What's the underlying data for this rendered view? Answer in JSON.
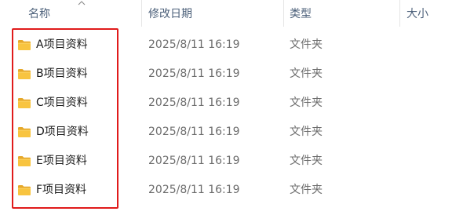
{
  "columns": {
    "name": "名称",
    "date": "修改日期",
    "type": "类型",
    "size": "大小"
  },
  "sort": {
    "column": "name",
    "direction": "ascending",
    "icon": "chevron-up-icon"
  },
  "items": [
    {
      "name": "A项目资料",
      "modified": "2025/8/11 16:19",
      "type": "文件夹",
      "icon": "folder-icon"
    },
    {
      "name": "B项目资料",
      "modified": "2025/8/11 16:19",
      "type": "文件夹",
      "icon": "folder-icon"
    },
    {
      "name": "C项目资料",
      "modified": "2025/8/11 16:19",
      "type": "文件夹",
      "icon": "folder-icon"
    },
    {
      "name": "D项目资料",
      "modified": "2025/8/11 16:19",
      "type": "文件夹",
      "icon": "folder-icon"
    },
    {
      "name": "E项目资料",
      "modified": "2025/8/11 16:19",
      "type": "文件夹",
      "icon": "folder-icon"
    },
    {
      "name": "F项目资料",
      "modified": "2025/8/11 16:19",
      "type": "文件夹",
      "icon": "folder-icon"
    }
  ],
  "colors": {
    "header_text": "#4c607a",
    "highlight_border": "#e01b1b",
    "folder_yellow": "#f8c440",
    "secondary_text": "#6d6d6d"
  }
}
